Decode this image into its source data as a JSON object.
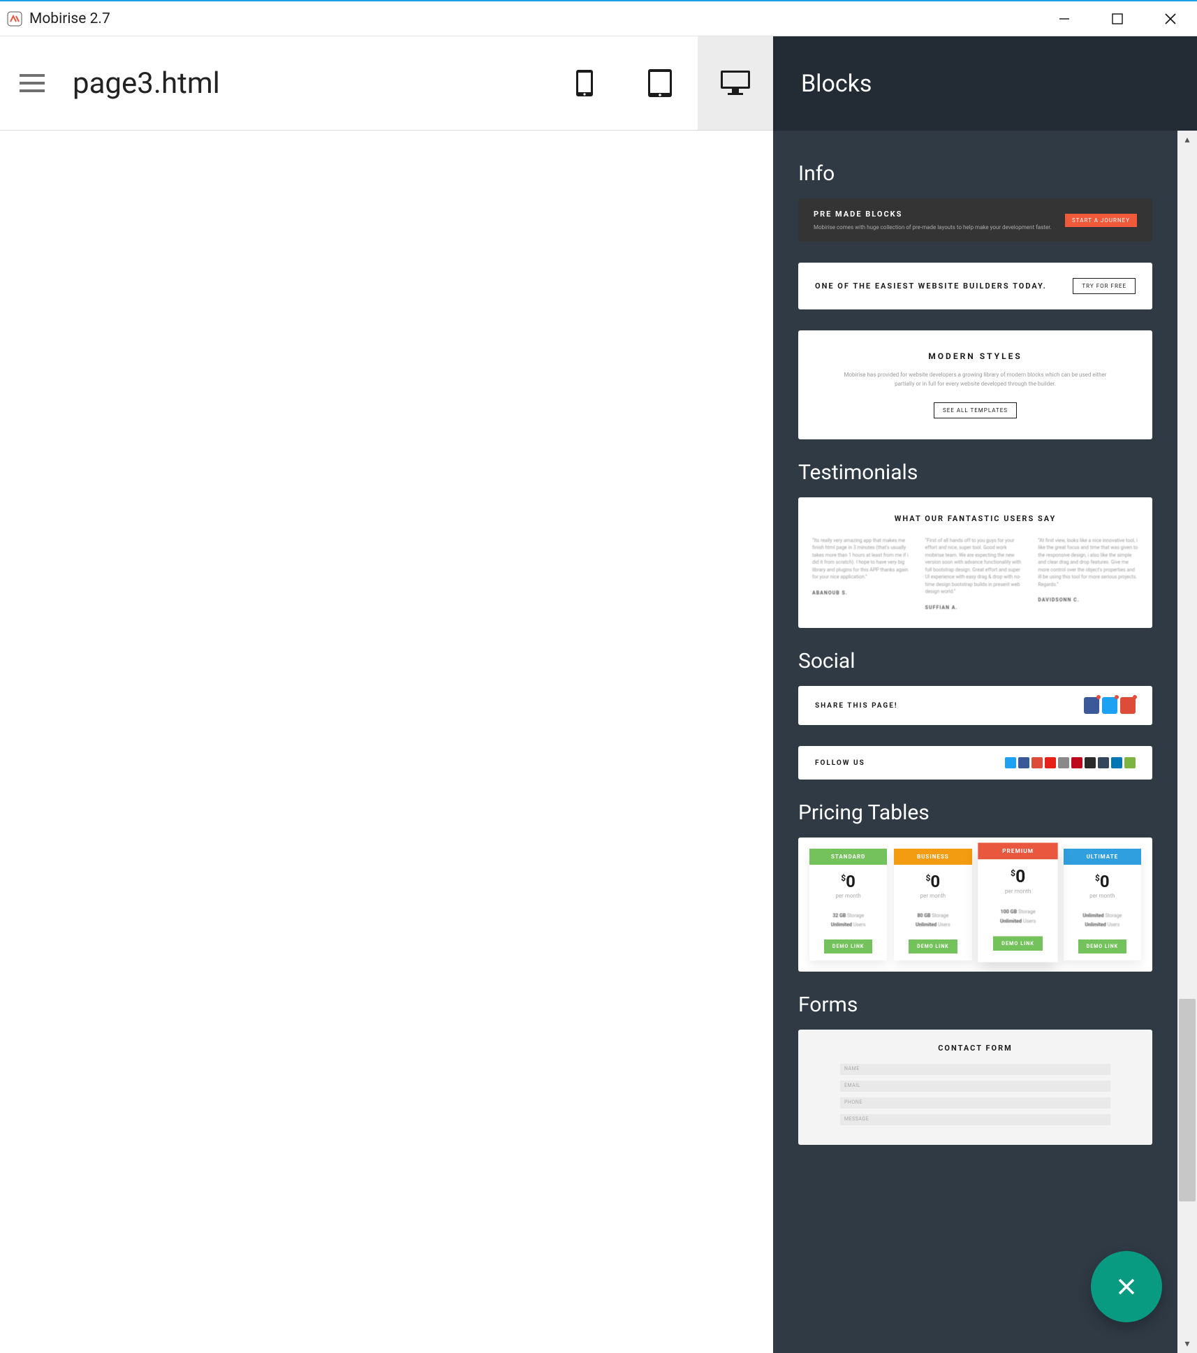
{
  "window": {
    "title": "Mobirise 2.7"
  },
  "toolbar": {
    "page_title": "page3.html"
  },
  "panel": {
    "title": "Blocks",
    "sections": {
      "info": {
        "label": "Info",
        "block1": {
          "heading": "PRE MADE BLOCKS",
          "sub": "Mobirise comes with huge collection of pre-made layouts to help make your development faster.",
          "button": "START A JOURNEY"
        },
        "block2": {
          "heading": "ONE OF THE EASIEST WEBSITE BUILDERS TODAY.",
          "button": "TRY FOR FREE"
        },
        "block3": {
          "heading": "MODERN STYLES",
          "sub": "Mobirise has provided for website developers a growing library of modern blocks which can be used either partially or in full for every website developed through the builder.",
          "button": "SEE ALL TEMPLATES"
        }
      },
      "testimonials": {
        "label": "Testimonials",
        "heading": "WHAT OUR FANTASTIC USERS SAY",
        "items": [
          {
            "text": "Its really very amazing app that makes me finish html page in 3 minutes (that's usually takes more than 1 hours at least from me if i did it from scratch). I hope to have very big library and plugins for this APP thanks again for your nice application.",
            "author": "ABANOUB S."
          },
          {
            "text": "First of all hands off to you guys for your effort and nice, super tool. Good work mobirise team. We are expecting the new version soon with advance functionality with full bootstrap design. Great effort and super UI experience with easy drag & drop with no-time design bootstrap builds in present web design world.",
            "author": "SUFFIAN A."
          },
          {
            "text": "At first view, looks like a nice innovative tool, i like the great focus and time that was given to the responsive design, i also like the simple and clear drag and drop features. Give me more control over the object's properties and ill be using this tool for more serious projects. Regards.",
            "author": "DAVIDSONN C."
          }
        ]
      },
      "social": {
        "label": "Social",
        "share_heading": "SHARE THIS PAGE!",
        "follow_heading": "FOLLOW US",
        "share_icons": [
          {
            "name": "facebook",
            "color": "#3b5998"
          },
          {
            "name": "twitter",
            "color": "#1da1f2"
          },
          {
            "name": "google",
            "color": "#dd4b39"
          }
        ],
        "follow_icons": [
          {
            "name": "twitter",
            "color": "#1da1f2"
          },
          {
            "name": "facebook",
            "color": "#3b5998"
          },
          {
            "name": "google",
            "color": "#dd4b39"
          },
          {
            "name": "youtube",
            "color": "#e62117"
          },
          {
            "name": "instagram",
            "color": "#8a8a8a"
          },
          {
            "name": "pinterest",
            "color": "#bd081c"
          },
          {
            "name": "behance",
            "color": "#2a2a2a"
          },
          {
            "name": "tumblr",
            "color": "#35465c"
          },
          {
            "name": "linkedin",
            "color": "#0077b5"
          },
          {
            "name": "rss",
            "color": "#7cb342"
          }
        ]
      },
      "pricing": {
        "label": "Pricing Tables",
        "plans": [
          {
            "name": "STANDARD",
            "color": "#74c25c",
            "price": "0",
            "per": "per month",
            "feat1_b": "32 GB",
            "feat1": " Storage",
            "feat2_b": "Unlimited",
            "feat2": " Users",
            "button": "DEMO LINK",
            "featured": false
          },
          {
            "name": "BUSINESS",
            "color": "#f39c12",
            "price": "0",
            "per": "per month",
            "feat1_b": "80 GB",
            "feat1": " Storage",
            "feat2_b": "Unlimited",
            "feat2": " Users",
            "button": "DEMO LINK",
            "featured": false
          },
          {
            "name": "PREMIUM",
            "color": "#e9573f",
            "price": "0",
            "per": "per month",
            "feat1_b": "100 GB",
            "feat1": " Storage",
            "feat2_b": "Unlimited",
            "feat2": " Users",
            "button": "DEMO LINK",
            "featured": true
          },
          {
            "name": "ULTIMATE",
            "color": "#2f9fe0",
            "price": "0",
            "per": "per month",
            "feat1_b": "Unlimited",
            "feat1": " Storage",
            "feat2_b": "Unlimited",
            "feat2": " Users",
            "button": "DEMO LINK",
            "featured": false
          }
        ]
      },
      "forms": {
        "label": "Forms",
        "heading": "CONTACT FORM",
        "fields": [
          "NAME",
          "EMAIL",
          "PHONE",
          "MESSAGE"
        ]
      }
    }
  }
}
